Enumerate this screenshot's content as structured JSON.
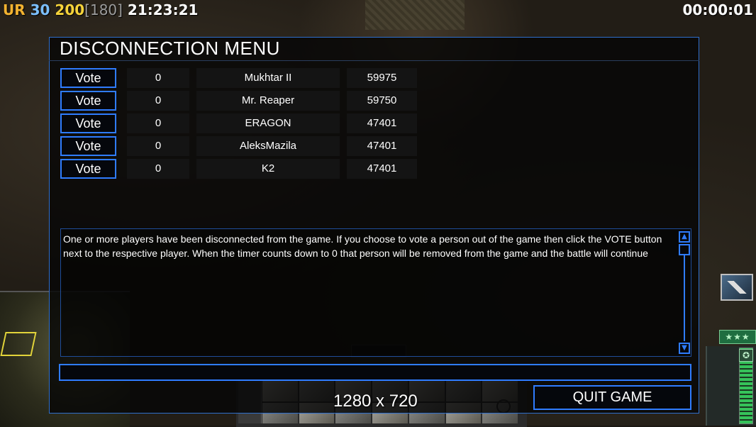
{
  "hud": {
    "faction": "UR",
    "value_a": "30",
    "value_b": "200",
    "value_c": "[180]",
    "clock": "21:23:21",
    "timer": "00:00:01"
  },
  "dialog": {
    "title": "DISCONNECTION MENU",
    "vote_label": "Vote",
    "players": [
      {
        "votes": "0",
        "name": "Mukhtar II",
        "ping": "59975"
      },
      {
        "votes": "0",
        "name": "Mr. Reaper",
        "ping": "59750"
      },
      {
        "votes": "0",
        "name": "ERAGON",
        "ping": "47401"
      },
      {
        "votes": "0",
        "name": "AleksMazila",
        "ping": "47401"
      },
      {
        "votes": "0",
        "name": "K2",
        "ping": "47401"
      }
    ],
    "message": "One or more players have been disconnected from the game. If you choose to vote a person out of the game then click the VOTE button next to the respective player. When the timer counts down to 0 that person will be removed from the game and the battle will continue",
    "chat_value": "",
    "quit_label": "QUIT GAME"
  },
  "overlay": {
    "resolution": "1280 x 720"
  },
  "colors": {
    "accent_blue": "#2f7cff",
    "faction_orange": "#f2b230",
    "value_blue": "#7cc0ff",
    "value_yellow": "#f5d33a"
  },
  "icons": {
    "satellite": "satellite-icon",
    "rank": "rank-stars-icon",
    "scroll_up": "triangle-up-icon",
    "scroll_down": "triangle-down-icon"
  },
  "side": {
    "rank_stars": "★★★"
  }
}
